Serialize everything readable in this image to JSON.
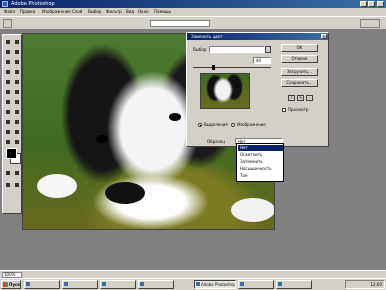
{
  "app": {
    "title": "Adobe Photoshop"
  },
  "menubar": {
    "items": [
      "Файл",
      "Правка",
      "Изображение",
      "Слой",
      "Выбор",
      "Фильтр",
      "Вид",
      "Окно",
      "Помощь"
    ]
  },
  "dialog": {
    "title": "Заменить цвет",
    "selection_label": "Выбор",
    "fuzziness_value": "40",
    "ok_label": "OK",
    "cancel_label": "Отмена",
    "load_label": "Загрузить...",
    "save_label": "Сохранить...",
    "preview_label": "Просмотр",
    "radio_selection": "Выделение",
    "radio_image": "Изображение",
    "sample_label": "Образец",
    "sample_value": "Нет"
  },
  "dropdown": {
    "items": [
      "Нет",
      "Осветлить",
      "Затемнить",
      "Насыщенность",
      "Тон"
    ],
    "selected_index": 0
  },
  "statusbar": {
    "zoom": "100%"
  },
  "taskbar": {
    "start_label": "Пуск",
    "tasks": [
      "",
      "",
      "",
      "",
      "Adobe Photoshop",
      "",
      ""
    ],
    "clock": "12:00"
  },
  "colors": {
    "titlebar": "#0a246a",
    "selection": "#0a246a",
    "foreground": "#000000",
    "background": "#ffffff"
  }
}
